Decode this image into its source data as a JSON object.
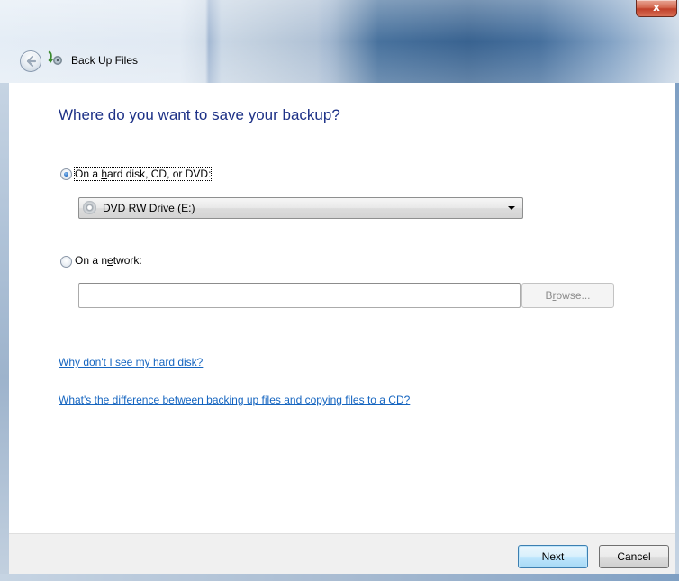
{
  "window": {
    "title": "Back Up Files",
    "close_symbol": "x"
  },
  "page": {
    "heading": "Where do you want to save your backup?"
  },
  "options": {
    "harddisk": {
      "label_pre": "On a ",
      "label_mnemonic": "h",
      "label_post": "ard disk, CD, or DVD:",
      "checked": true,
      "selected_drive": "DVD RW Drive (E:)"
    },
    "network": {
      "label_pre": "On a n",
      "label_mnemonic": "e",
      "label_post": "twork:",
      "checked": false,
      "input_value": "",
      "browse_pre": "B",
      "browse_mnemonic": "r",
      "browse_post": "owse..."
    }
  },
  "links": {
    "harddisk_help": "Why don't I see my hard disk?",
    "difference_help": "What's the difference between backing up files and copying files to a CD?"
  },
  "footer": {
    "next_label": "Next",
    "cancel_label": "Cancel"
  },
  "icons": {
    "back": "back-arrow-icon",
    "app": "backup-icon",
    "drive": "dvd-drive-icon",
    "dropdown": "chevron-down-icon"
  },
  "colors": {
    "heading": "#1e3287",
    "link": "#1565c0",
    "footer_bg": "#f0f0f0"
  }
}
